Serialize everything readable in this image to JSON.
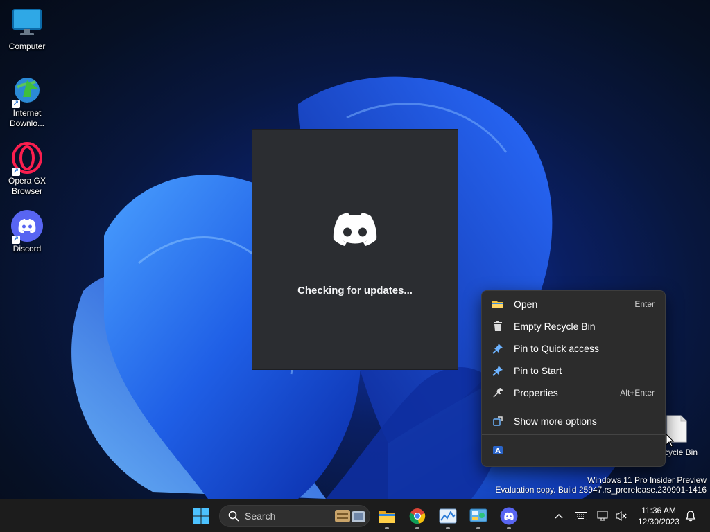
{
  "desktop": {
    "icons": [
      {
        "label": "Computer"
      },
      {
        "label": "Internet Downlo..."
      },
      {
        "label": "Opera GX Browser"
      },
      {
        "label": "Discord"
      }
    ],
    "recycle_bin_label": "cycle Bin"
  },
  "updater": {
    "status": "Checking for updates..."
  },
  "context_menu": {
    "items": [
      {
        "label": "Open",
        "accelerator": "Enter"
      },
      {
        "label": "Empty Recycle Bin",
        "accelerator": ""
      },
      {
        "label": "Pin to Quick access",
        "accelerator": ""
      },
      {
        "label": "Pin to Start",
        "accelerator": ""
      },
      {
        "label": "Properties",
        "accelerator": "Alt+Enter"
      },
      {
        "label": "Show more options",
        "accelerator": ""
      }
    ]
  },
  "watermark": {
    "line1": "Windows 11 Pro Insider Preview",
    "line2": "Evaluation copy. Build 25947.rs_prerelease.230901-1416"
  },
  "taskbar": {
    "search_placeholder": "Search",
    "time": "11:36 AM",
    "date": "12/30/2023"
  },
  "colors": {
    "discord": "#5865f2",
    "accent": "#0078d4",
    "menu_bg": "#2c2c2c"
  }
}
